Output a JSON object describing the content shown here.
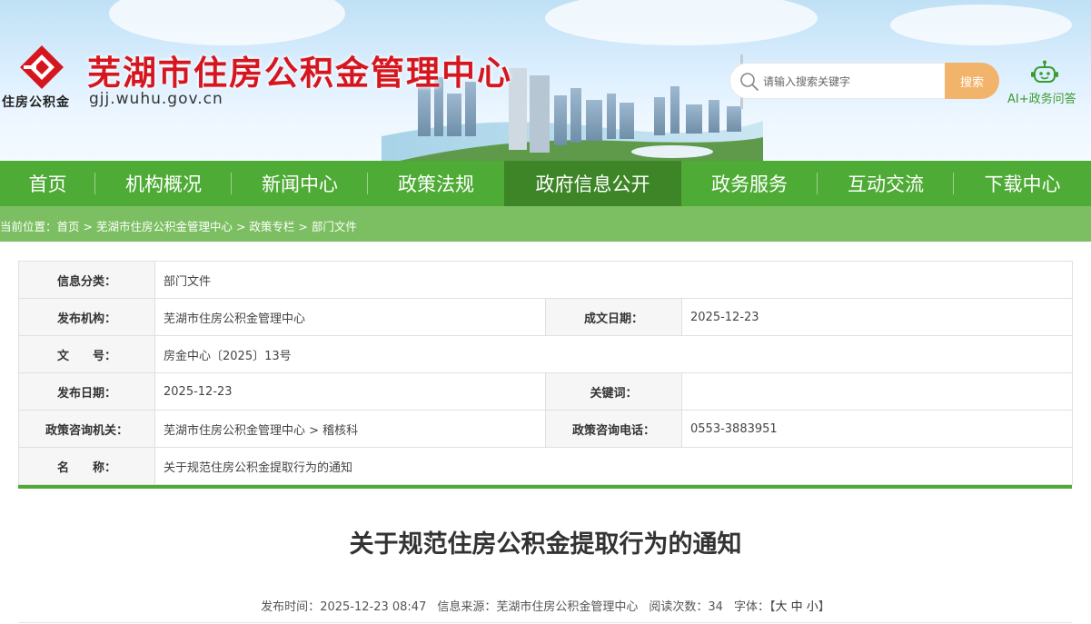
{
  "header": {
    "site_title": "芜湖市住房公积金管理中心",
    "logo_text": "住房公积金",
    "domain": "gjj.wuhu.gov.cn",
    "search_placeholder": "请输入搜索关键字",
    "search_button": "搜索",
    "ai_label": "AI+政务问答"
  },
  "nav": {
    "items": [
      {
        "label": "首页"
      },
      {
        "label": "机构概况"
      },
      {
        "label": "新闻中心"
      },
      {
        "label": "政策法规"
      },
      {
        "label": "政府信息公开",
        "active": true
      },
      {
        "label": "政务服务"
      },
      {
        "label": "互动交流"
      },
      {
        "label": "下载中心"
      }
    ]
  },
  "breadcrumb": {
    "prefix": "当前位置：",
    "items": [
      "首页",
      "芜湖市住房公积金管理中心",
      "政策专栏",
      "部门文件"
    ],
    "separator": " > "
  },
  "info": {
    "category_label": "信息分类：",
    "category": "部门文件",
    "publisher_label": "发布机构：",
    "publisher": "芜湖市住房公积金管理中心",
    "created_label": "成文日期：",
    "created": "2025-12-23",
    "doc_no_label": "文　　号：",
    "doc_no": "房金中心〔2025〕13号",
    "publish_date_label": "发布日期：",
    "publish_date": "2025-12-23",
    "keywords_label": "关键词：",
    "keywords": "",
    "consult_org_label": "政策咨询机关：",
    "consult_org": "芜湖市住房公积金管理中心 > 稽核科",
    "consult_phone_label": "政策咨询电话：",
    "consult_phone": "0553-3883951",
    "name_label": "名　　称：",
    "name": "关于规范住房公积金提取行为的通知"
  },
  "article": {
    "title": "关于规范住房公积金提取行为的通知",
    "time_label": "发布时间：",
    "time": "2025-12-23 08:47",
    "source_label": "信息来源：",
    "source": "芜湖市住房公积金管理中心",
    "views_label": "阅读次数：",
    "views": "34",
    "font_label": "字体：",
    "font_open": "【",
    "font_large": "大",
    "font_medium": "中",
    "font_small": "小",
    "font_close": "】"
  },
  "colors": {
    "brand_red": "#d6161f",
    "nav_green": "#4eab35",
    "nav_active": "#3d8526",
    "crumb_green": "#7cbf62",
    "search_button": "#f2b36b"
  },
  "icons": [
    "logo-emblem-icon",
    "search-icon",
    "ai-robot-icon"
  ]
}
